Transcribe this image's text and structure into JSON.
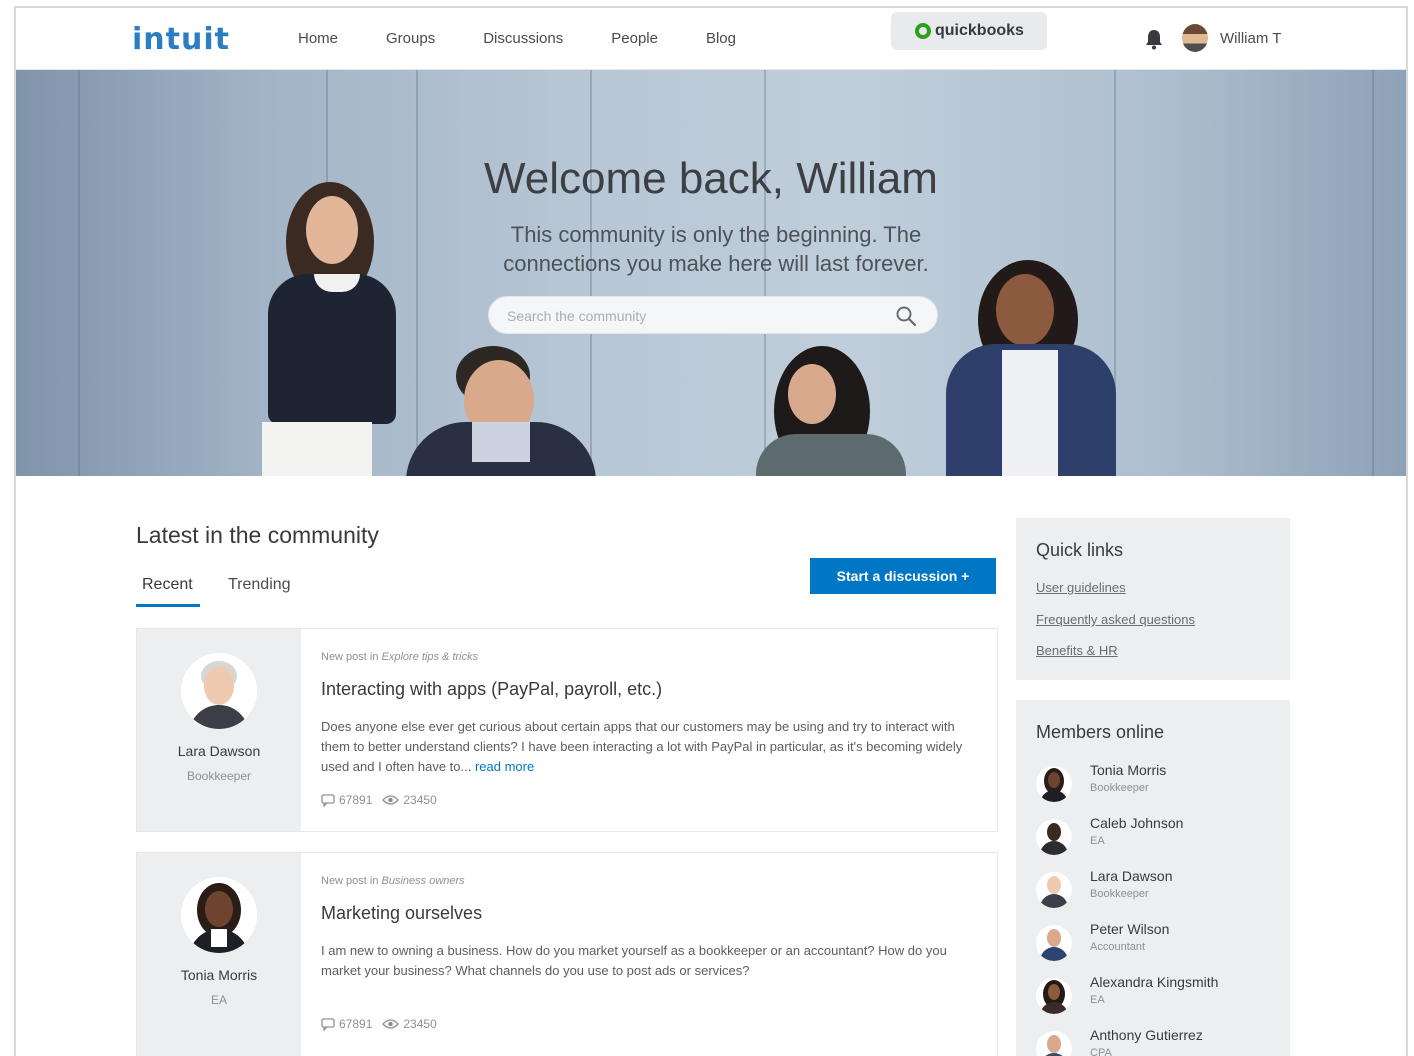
{
  "header": {
    "logo": "intuit",
    "nav": [
      "Home",
      "Groups",
      "Discussions",
      "People",
      "Blog"
    ],
    "product_badge": "quickbooks",
    "user_name": "William T"
  },
  "hero": {
    "title": "Welcome back, William",
    "subtitle": "This community is only the beginning. The connections you make here will last forever.",
    "search_placeholder": "Search the community"
  },
  "main": {
    "section_title": "Latest in the community",
    "tabs": [
      "Recent",
      "Trending"
    ],
    "start_button": "Start a discussion +",
    "posts": [
      {
        "author": "Lara Dawson",
        "role": "Bookkeeper",
        "meta_prefix": "New post in ",
        "meta_group": "Explore tips & tricks",
        "title": "Interacting with apps (PayPal, payroll, etc.)",
        "text": "Does anyone else ever get curious about certain apps that our customers may be using and try to interact with them to better understand clients? I have been interacting a lot with PayPal in particular, as it's becoming widely used and I often have to... ",
        "read_more": "read more",
        "comments": "67891",
        "views": "23450"
      },
      {
        "author": "Tonia Morris",
        "role": "EA",
        "meta_prefix": "New post in ",
        "meta_group": "Business owners",
        "title": "Marketing ourselves",
        "text": "I am new to owning a business. How do you market yourself as a bookkeeper or an accountant? How do you market your business? What channels do you use to post ads or services?",
        "read_more": "",
        "comments": "67891",
        "views": "23450"
      }
    ]
  },
  "sidebar": {
    "quick_links_title": "Quick links",
    "quick_links": [
      "User guidelines",
      "Frequently asked questions",
      "Benefits & HR"
    ],
    "members_title": "Members online",
    "members": [
      {
        "name": "Tonia Morris",
        "role": "Bookkeeper"
      },
      {
        "name": "Caleb Johnson",
        "role": "EA"
      },
      {
        "name": "Lara Dawson",
        "role": "Bookkeeper"
      },
      {
        "name": "Peter Wilson",
        "role": "Accountant"
      },
      {
        "name": "Alexandra Kingsmith",
        "role": "EA"
      },
      {
        "name": "Anthony Gutierrez",
        "role": "CPA"
      }
    ]
  },
  "colors": {
    "brand_blue": "#0077c5",
    "logo_blue": "#2b7ec1",
    "quickbooks_green": "#2ca01c"
  }
}
